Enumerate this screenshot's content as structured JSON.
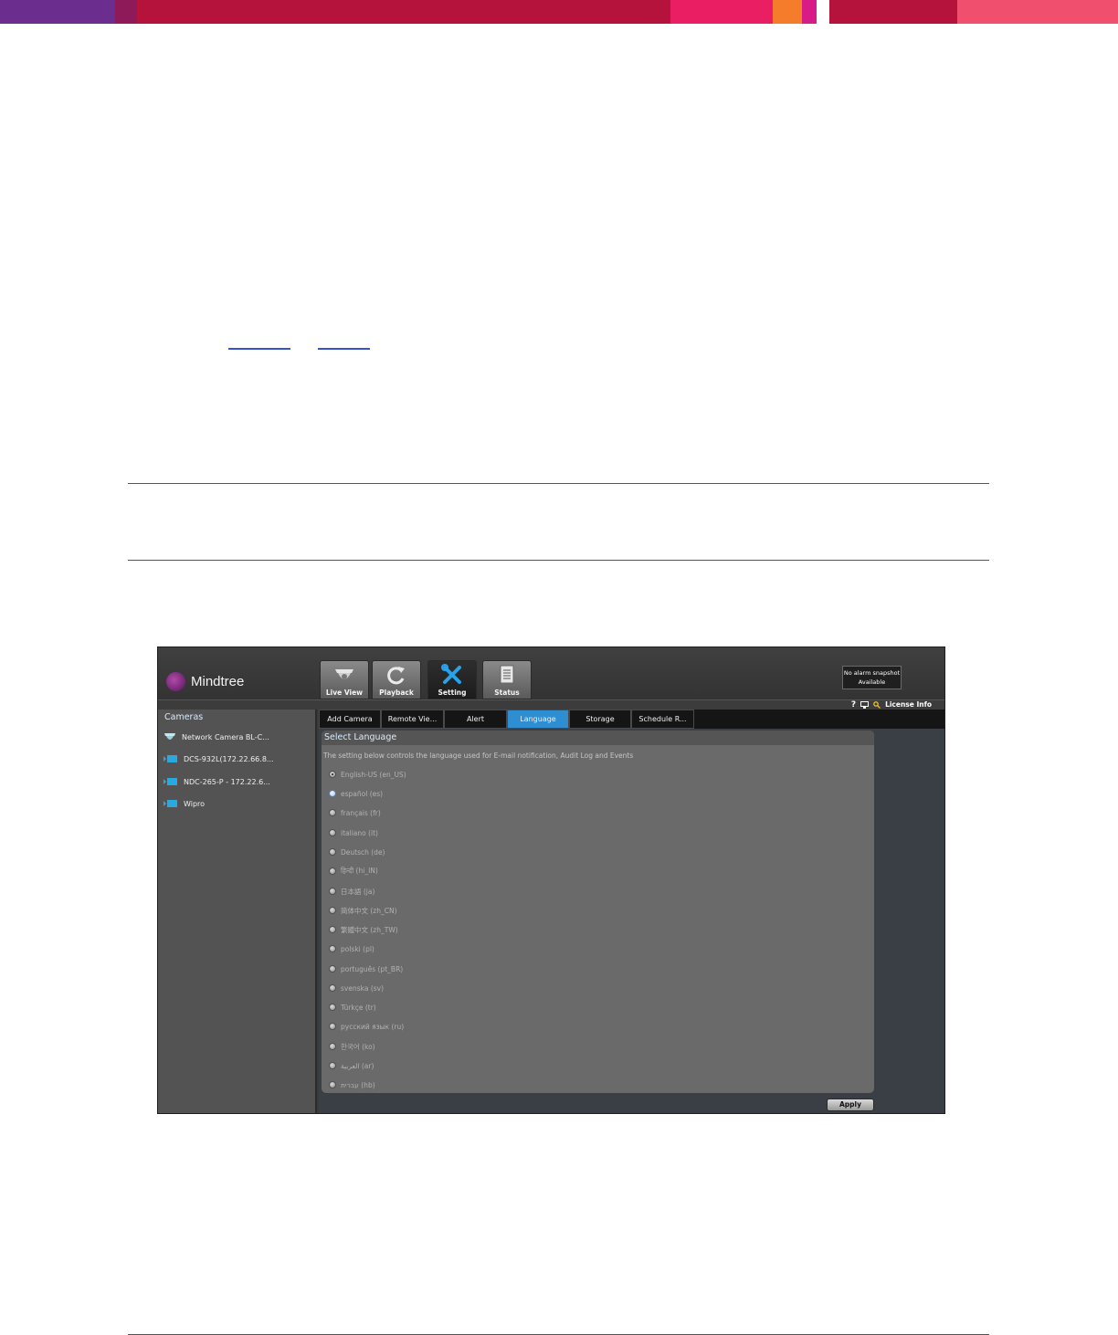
{
  "colors": {
    "banner_segments": [
      "#6c2e8e",
      "#8e1a5a",
      "#b5133c",
      "#e91e63",
      "#f57c2a",
      "#d81b86",
      "#ffffff",
      "#b5133c",
      "#f0506e"
    ],
    "active_tab": "#2f8ed1",
    "panel_bg": "#6a6a6a"
  },
  "app": {
    "logo_text": "Mindtree",
    "nav": [
      {
        "label": "Live View",
        "icon": "camera-dome-icon"
      },
      {
        "label": "Playback",
        "icon": "refresh-icon"
      },
      {
        "label": "Setting",
        "icon": "tools-icon"
      },
      {
        "label": "Status",
        "icon": "document-icon"
      }
    ],
    "alarm": {
      "line1": "No alarm snapshot",
      "line2": "Available"
    },
    "util": {
      "help": "?",
      "license": "License Info"
    }
  },
  "sidebar": {
    "title": "Cameras",
    "cameras": [
      {
        "label": "Network Camera BL-C...",
        "icon": "dome-camera-icon"
      },
      {
        "label": "DCS-932L(172.22.66.8...",
        "icon": "camera-icon"
      },
      {
        "label": "NDC-265-P - 172.22.6...",
        "icon": "camera-icon"
      },
      {
        "label": "Wipro",
        "icon": "camera-icon"
      }
    ]
  },
  "tabs": [
    "Add Camera",
    "Remote Vie...",
    "Alert",
    "Language",
    "Storage",
    "Schedule R..."
  ],
  "active_tab": "Language",
  "panel": {
    "title": "Select Language",
    "description": "The setting below controls the language used for E-mail notification, Audit Log and Events"
  },
  "languages": [
    "English-US (en_US)",
    "español (es)",
    "français (fr)",
    "italiano (it)",
    "Deutsch (de)",
    "हिन्दी (hi_IN)",
    "日本語 (ja)",
    "简体中文 (zh_CN)",
    "繁體中文 (zh_TW)",
    "polski (pl)",
    "português (pt_BR)",
    "svenska (sv)",
    "Türkçe (tr)",
    "русский язык (ru)",
    "한국어 (ko)",
    "العربية (ar)",
    "עברית (hb)"
  ],
  "selected_language": "English-US (en_US)",
  "apply_label": "Apply"
}
